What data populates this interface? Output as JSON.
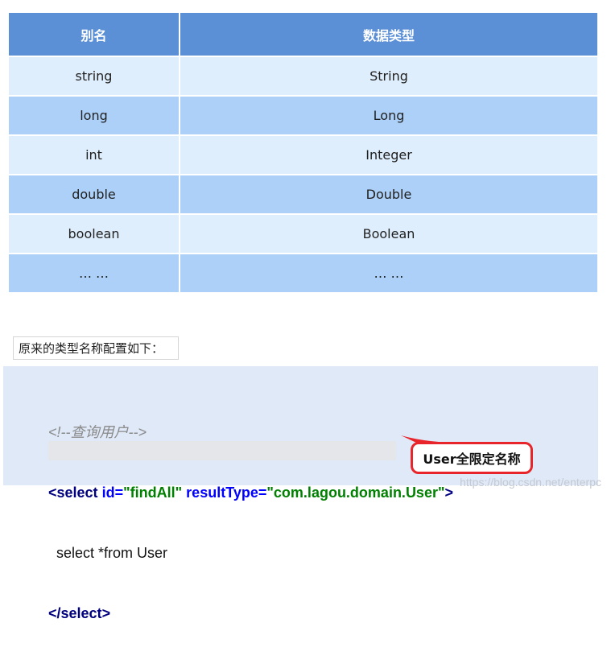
{
  "table": {
    "headers": [
      "别名",
      "数据类型"
    ],
    "rows": [
      [
        "string",
        "String"
      ],
      [
        "long",
        "Long"
      ],
      [
        "int",
        "Integer"
      ],
      [
        "double",
        "Double"
      ],
      [
        "boolean",
        "Boolean"
      ],
      [
        "… …",
        "… …"
      ]
    ]
  },
  "caption": "原来的类型名称配置如下：",
  "code": {
    "comment": "<!--查询用户-->",
    "line2": {
      "open": "<",
      "tag": "select",
      "attr1": "id",
      "eq1": "=",
      "val1": "\"findAll\"",
      "attr2": "resultType",
      "eq2": "=",
      "val2": "\"com.lagou.domain.User\"",
      "close": ">"
    },
    "line3": "select *from User",
    "line4": {
      "open": "</",
      "tag": "select",
      "close": ">"
    }
  },
  "annotation": {
    "text": "User全限定名称",
    "color": "#e8252a"
  },
  "watermark": "https://blog.csdn.net/enterpc"
}
